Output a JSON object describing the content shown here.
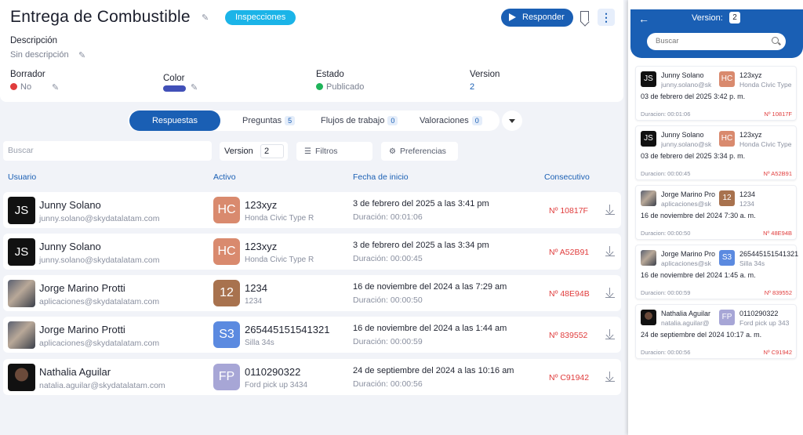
{
  "header": {
    "title": "Entrega de Combustible",
    "badge": "Inspecciones",
    "respond_label": "Responder",
    "description_label": "Descripción",
    "description_value": "Sin descripción",
    "borrador_label": "Borrador",
    "borrador_value": "No",
    "color_label": "Color",
    "color_value": "#4150b8",
    "estado_label": "Estado",
    "estado_value": "Publicado",
    "version_label": "Version",
    "version_value": "2"
  },
  "tabs": [
    {
      "label": "Respuestas",
      "count": ""
    },
    {
      "label": "Preguntas",
      "count": "5"
    },
    {
      "label": "Flujos de trabajo",
      "count": "0"
    },
    {
      "label": "Valoraciones",
      "count": "0"
    }
  ],
  "toolbar": {
    "search_placeholder": "Buscar",
    "version_label": "Version",
    "version_value": "2",
    "filters_label": "Filtros",
    "preferences_label": "Preferencias"
  },
  "table": {
    "columns": [
      "Usuario",
      "Activo",
      "Fecha de inicio",
      "Consecutivo"
    ],
    "rows": [
      {
        "avatar": "JS",
        "user": "Junny Solano",
        "email": "junny.solano@skydatalatam.com",
        "asset_code": "HC",
        "asset_color": "#d98a6e",
        "asset": "123xyz",
        "asset_sub": "Honda Civic Type R",
        "date": "3 de febrero del 2025 a las 3:41 pm",
        "duration": "Duración: 00:01:06",
        "consec": "Nº 10817F"
      },
      {
        "avatar": "JS",
        "user": "Junny Solano",
        "email": "junny.solano@skydatalatam.com",
        "asset_code": "HC",
        "asset_color": "#d98a6e",
        "asset": "123xyz",
        "asset_sub": "Honda Civic Type R",
        "date": "3 de febrero del 2025 a las 3:34 pm",
        "duration": "Duración: 00:00:45",
        "consec": "Nº A52B91"
      },
      {
        "avatar": "",
        "user": "Jorge Marino Protti",
        "email": "aplicaciones@skydatalatam.com",
        "asset_code": "12",
        "asset_color": "#a8724e",
        "asset": "1234",
        "asset_sub": "1234",
        "date": "16 de noviembre del 2024 a las 7:29 am",
        "duration": "Duración: 00:00:50",
        "consec": "Nº 48E94B"
      },
      {
        "avatar": "",
        "user": "Jorge Marino Protti",
        "email": "aplicaciones@skydatalatam.com",
        "asset_code": "S3",
        "asset_color": "#5b8ae0",
        "asset": "265445151541321",
        "asset_sub": "Silla 34s",
        "date": "16 de noviembre del 2024 a las 1:44 am",
        "duration": "Duración: 00:00:59",
        "consec": "Nº 839552"
      },
      {
        "avatar": "",
        "user": "Nathalia Aguilar",
        "email": "natalia.aguilar@skydatalatam.com",
        "asset_code": "FP",
        "asset_color": "#a7a6d6",
        "asset": "0110290322",
        "asset_sub": "Ford pick up 3434",
        "date": "24 de septiembre del 2024 a las 10:16 am",
        "duration": "Duración: 00:00:56",
        "consec": "Nº C91942"
      }
    ]
  },
  "side": {
    "version_label": "Version:",
    "version_value": "2",
    "search_placeholder": "Buscar",
    "cards": [
      {
        "avatar": "JS",
        "user": "Junny Solano",
        "email": "junny.solano@sk",
        "asset_code": "HC",
        "asset_color": "#d98a6e",
        "asset": "123xyz",
        "asset_sub": "Honda Civic Type",
        "date": "03 de febrero del 2025 3:42 p. m.",
        "duration": "Duracion: 00:01:06",
        "consec": "Nº 10817F"
      },
      {
        "avatar": "JS",
        "user": "Junny Solano",
        "email": "junny.solano@sk",
        "asset_code": "HC",
        "asset_color": "#d98a6e",
        "asset": "123xyz",
        "asset_sub": "Honda Civic Type",
        "date": "03 de febrero del 2025 3:34 p. m.",
        "duration": "Duracion: 00:00:45",
        "consec": "Nº A52B91"
      },
      {
        "avatar": "",
        "user": "Jorge Marino Pro",
        "email": "aplicaciones@sk",
        "asset_code": "12",
        "asset_color": "#a8724e",
        "asset": "1234",
        "asset_sub": "1234",
        "date": "16 de noviembre del 2024 7:30 a. m.",
        "duration": "Duracion: 00:00:50",
        "consec": "Nº 48E94B"
      },
      {
        "avatar": "",
        "user": "Jorge Marino Pro",
        "email": "aplicaciones@sk",
        "asset_code": "S3",
        "asset_color": "#5b8ae0",
        "asset": "265445151541321",
        "asset_sub": "Silla 34s",
        "date": "16 de noviembre del 2024 1:45 a. m.",
        "duration": "Duracion: 00:00:59",
        "consec": "Nº 839552"
      },
      {
        "avatar": "",
        "user": "Nathalia Aguilar",
        "email": "natalia.aguilar@",
        "asset_code": "FP",
        "asset_color": "#a7a6d6",
        "asset": "0110290322",
        "asset_sub": "Ford pick up 343",
        "date": "24 de septiembre del 2024 10:17 a. m.",
        "duration": "Duracion: 00:00:56",
        "consec": "Nº C91942"
      }
    ]
  }
}
